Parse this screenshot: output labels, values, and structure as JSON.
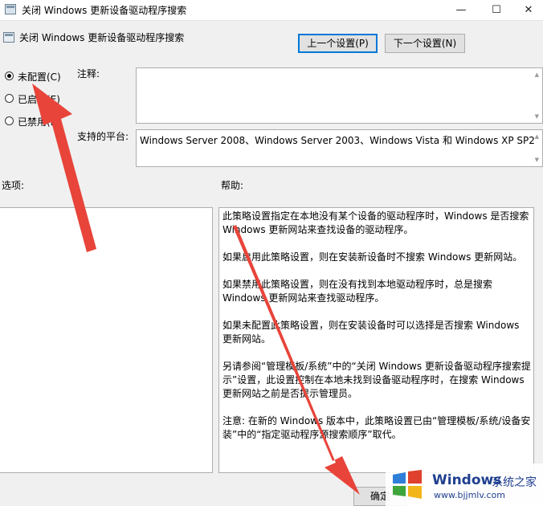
{
  "window": {
    "title": "关闭 Windows 更新设备驱动程序搜索",
    "minimize": "—",
    "maximize": "☐",
    "close": "✕"
  },
  "header": {
    "setting_title": "关闭 Windows 更新设备驱动程序搜索",
    "prev_button": "上一个设置(P)",
    "next_button": "下一个设置(N)"
  },
  "state": {
    "options": [
      {
        "label": "未配置(C)",
        "selected": true
      },
      {
        "label": "已启用(E)",
        "selected": false
      },
      {
        "label": "已禁用(D)",
        "selected": false
      }
    ]
  },
  "labels": {
    "comment": "注释:",
    "platform": "支持的平台:",
    "options": "选项:",
    "help": "帮助:"
  },
  "comment_value": "",
  "platform_value": "Windows Server 2008、Windows Server 2003、Windows Vista 和 Windows XP SP2",
  "help_text": [
    "此策略设置指定在本地没有某个设备的驱动程序时，Windows 是否搜索 Windows 更新网站来查找设备的驱动程序。",
    "如果启用此策略设置，则在安装新设备时不搜索 Windows 更新网站。",
    "如果禁用此策略设置，则在没有找到本地驱动程序时，总是搜索 Windows 更新网站来查找驱动程序。",
    "如果未配置此策略设置，则在安装设备时可以选择是否搜索 Windows 更新网站。",
    "另请参阅“管理模板/系统”中的“关闭 Windows 更新设备驱动程序搜索提示”设置，此设置控制在本地未找到设备驱动程序时，在搜索 Windows 更新网站之前是否提示管理员。",
    "注意: 在新的 Windows 版本中，此策略设置已由“管理模板/系统/设备安装”中的“指定驱动程序源搜索顺序”取代。"
  ],
  "footer": {
    "ok_button": "确定"
  },
  "watermark": {
    "brand": "Windows",
    "cn": "系统之家",
    "url": "www.bjjmlv.com"
  },
  "colors": {
    "accent": "#0078d7",
    "arrow": "#e8443a",
    "window_bg": "#f0f0f0"
  }
}
